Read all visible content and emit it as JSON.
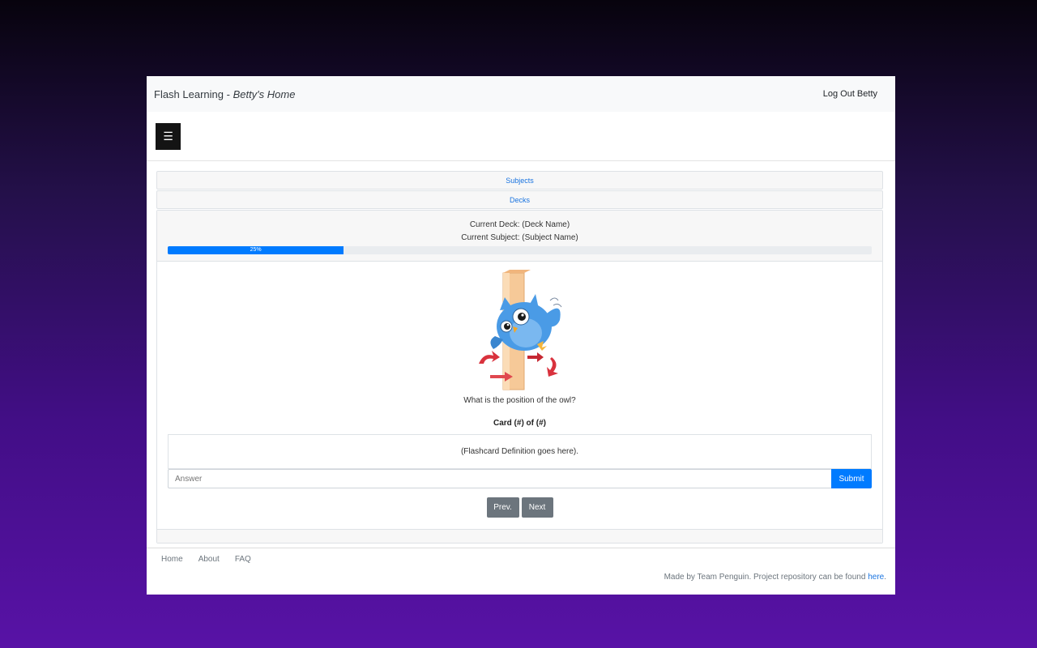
{
  "header": {
    "app_name": "Flash Learning",
    "separator": " - ",
    "home_label": "Betty's Home",
    "logout_label": "Log Out Betty"
  },
  "menu": {
    "icon_glyph": "☰",
    "icon_name": "hamburger-menu-icon"
  },
  "accordion": {
    "subjects_label": "Subjects",
    "decks_label": "Decks"
  },
  "study": {
    "current_deck": "Current Deck: (Deck Name)",
    "current_subject": "Current Subject: (Subject Name)",
    "progress_percent": 25,
    "progress_label": "25%",
    "image_name": "owl-on-post-illustration",
    "question": "What is the position of the owl?",
    "card_counter": "Card (#) of (#)",
    "definition": "(Flashcard Definition goes here).",
    "answer_placeholder": "Answer",
    "submit_label": "Submit",
    "prev_label": "Prev.",
    "next_label": "Next"
  },
  "footer": {
    "links": [
      "Home",
      "About",
      "FAQ"
    ],
    "credit_text": "Made by Team Penguin. Project repository can be found ",
    "credit_link": "here",
    "credit_end": "."
  },
  "colors": {
    "primary": "#007bff",
    "secondary": "#6c757d",
    "menu_button": "#141414",
    "link": "#1a74e0"
  }
}
